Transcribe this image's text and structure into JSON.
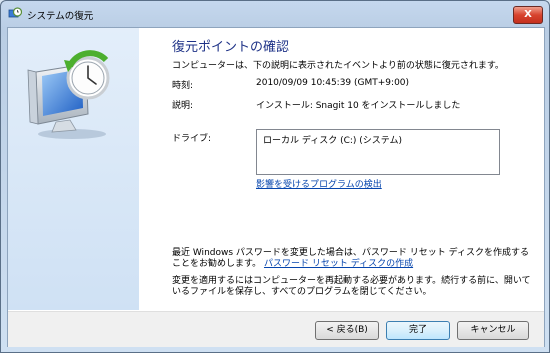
{
  "window": {
    "title": "システムの復元",
    "close_label": "X"
  },
  "page": {
    "heading": "復元ポイントの確認",
    "intro": "コンピューターは、下の説明に表示されたイベントより前の状態に復元されます。",
    "time_label": "時刻:",
    "time_value": "2010/09/09 10:45:39 (GMT+9:00)",
    "desc_label": "説明:",
    "desc_value": "インストール: Snagit 10 をインストールしました",
    "drives_label": "ドライブ:",
    "drives": [
      "ローカル ディスク (C:) (システム)"
    ],
    "scan_link": "影響を受けるプログラムの検出",
    "password_note": "最近 Windows パスワードを変更した場合は、パスワード リセット ディスクを作成することをお勧めします。",
    "password_link": "パスワード リセット ディスクの作成",
    "restart_note": "変更を適用するにはコンピューターを再起動する必要があります。続行する前に、開いているファイルを保存し、すべてのプログラムを閉じてください。"
  },
  "buttons": {
    "back": "< 戻る(B)",
    "finish": "完了",
    "cancel": "キャンセル"
  },
  "icons": {
    "title": "system-restore-icon",
    "art": "system-restore-clock-icon"
  },
  "colors": {
    "heading": "#1e3287",
    "link": "#0645ad",
    "close": "#d7432e"
  }
}
